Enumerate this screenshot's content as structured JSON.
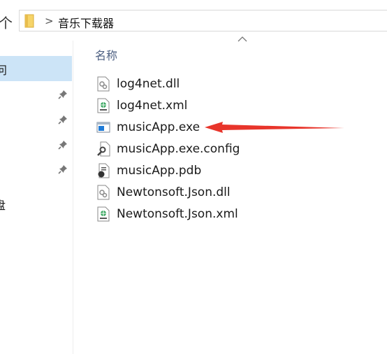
{
  "toolbar": {
    "up_label": "个"
  },
  "address": {
    "current_folder": "音乐下载器"
  },
  "nav": {
    "selected_label": "问",
    "disk_label": "盘",
    "pins": [
      "pin",
      "pin",
      "pin",
      "pin"
    ]
  },
  "list": {
    "column_name": "名称",
    "files": [
      {
        "name": "log4net.dll",
        "icon": "dll-file-icon"
      },
      {
        "name": "log4net.xml",
        "icon": "xml-file-icon"
      },
      {
        "name": "musicApp.exe",
        "icon": "exe-file-icon"
      },
      {
        "name": "musicApp.exe.config",
        "icon": "config-file-icon"
      },
      {
        "name": "musicApp.pdb",
        "icon": "pdb-file-icon"
      },
      {
        "name": "Newtonsoft.Json.dll",
        "icon": "dll-file-icon"
      },
      {
        "name": "Newtonsoft.Json.xml",
        "icon": "xml-file-icon"
      }
    ]
  },
  "colors": {
    "selection": "#cce4f7",
    "arrow": "#e8352b",
    "header_text": "#4d6082"
  }
}
